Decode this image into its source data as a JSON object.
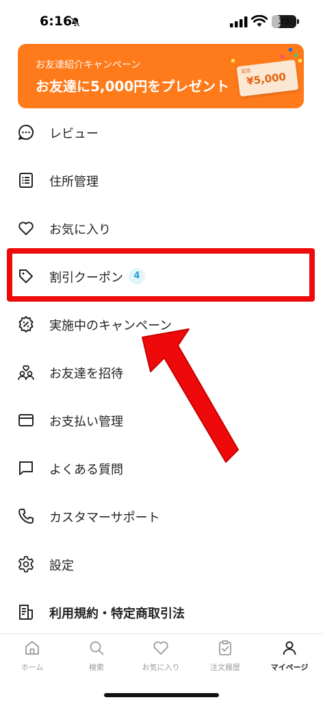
{
  "status_bar": {
    "time": "6:16",
    "battery": "35",
    "battery_level_percent": 35
  },
  "banner": {
    "subtitle": "お友達紹介キャンペーン",
    "title": "お友達に5,000円をプレゼント",
    "voucher_tag": "記念",
    "voucher_amount": "¥5,000",
    "color": "#ff7a1a"
  },
  "menu": {
    "items": [
      {
        "label": "レビュー",
        "icon": "chat-bubble-icon"
      },
      {
        "label": "住所管理",
        "icon": "list-icon"
      },
      {
        "label": "お気に入り",
        "icon": "heart-icon"
      },
      {
        "label": "割引クーポン",
        "icon": "tag-icon",
        "badge": "4"
      },
      {
        "label": "実施中のキャンペーン",
        "icon": "percent-badge-icon"
      },
      {
        "label": "お友達を招待",
        "icon": "invite-friends-icon"
      },
      {
        "label": "お支払い管理",
        "icon": "credit-card-icon"
      },
      {
        "label": "よくある質問",
        "icon": "message-square-icon"
      },
      {
        "label": "カスタマーサポート",
        "icon": "phone-icon"
      },
      {
        "label": "設定",
        "icon": "gear-icon"
      },
      {
        "label": "利用規約・特定商取引法",
        "icon": "document-icon"
      }
    ]
  },
  "annotation": {
    "highlight_color": "#ee0a0a"
  },
  "tab_bar": {
    "tabs": [
      {
        "label": "ホーム",
        "icon": "home-icon"
      },
      {
        "label": "検索",
        "icon": "search-icon"
      },
      {
        "label": "お気に入り",
        "icon": "heart-icon"
      },
      {
        "label": "注文履歴",
        "icon": "clipboard-icon"
      },
      {
        "label": "マイページ",
        "icon": "person-icon",
        "active": true
      }
    ]
  }
}
